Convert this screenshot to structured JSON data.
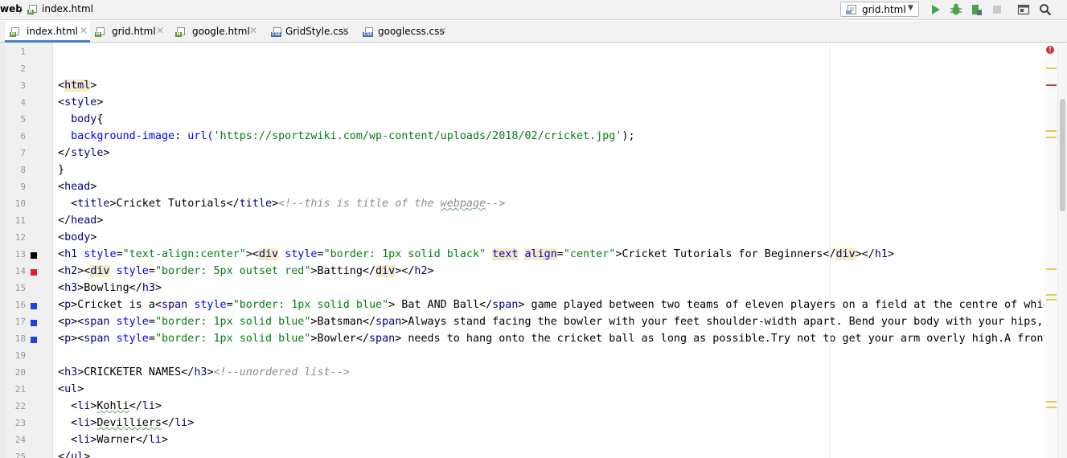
{
  "breadcrumb": {
    "root": "web",
    "separator": "〉",
    "file": "index.html"
  },
  "run_config": {
    "label": "grid.html"
  },
  "tabs": [
    {
      "label": "index.html",
      "close": "✕",
      "active": true,
      "icon": "html-file-icon"
    },
    {
      "label": "grid.html",
      "close": "✕",
      "active": false,
      "icon": "html-file-icon"
    },
    {
      "label": "google.html",
      "close": "✕",
      "active": false,
      "icon": "html-file-icon"
    },
    {
      "label": "GridStyle.css",
      "close": "✕",
      "active": false,
      "icon": "css-file-icon"
    },
    {
      "label": "googlecss.css",
      "close": "✕",
      "active": false,
      "icon": "css-file-icon"
    }
  ],
  "gutter": {
    "line_numbers": [
      "1",
      "2",
      "3",
      "4",
      "5",
      "6",
      "7",
      "8",
      "9",
      "10",
      "11",
      "12",
      "13",
      "14",
      "15",
      "16",
      "17",
      "18",
      "19",
      "20",
      "21",
      "22",
      "23",
      "24",
      "25"
    ],
    "color_markers": [
      {
        "line": "13",
        "color": "#000000"
      },
      {
        "line": "14",
        "color": "#e51f1f"
      },
      {
        "line": "16",
        "color": "#1f3fe5"
      },
      {
        "line": "17",
        "color": "#1f3fe5"
      },
      {
        "line": "18",
        "color": "#1f3fe5"
      }
    ]
  },
  "error_indicator": "!",
  "colors": {
    "accent": "#4083c9",
    "tag": "#000080",
    "attr": "#0000ff",
    "string": "#067d17",
    "comment": "#8c8c8c",
    "tag_highlight": "#f6ebbc",
    "warning_mark": "#e8c948",
    "error_mark": "#c94040"
  },
  "code_lines": [
    [],
    [],
    [
      {
        "t": "<",
        "c": "p"
      },
      {
        "t": "html",
        "c": "th"
      },
      {
        "t": ">",
        "c": "p"
      }
    ],
    [
      {
        "t": "<",
        "c": "p"
      },
      {
        "t": "style",
        "c": "t"
      },
      {
        "t": ">",
        "c": "p"
      }
    ],
    [
      {
        "t": "  ",
        "c": "p"
      },
      {
        "t": "body",
        "c": "t"
      },
      {
        "t": "{",
        "c": "p"
      }
    ],
    [
      {
        "t": "  ",
        "c": "p"
      },
      {
        "t": "background-image",
        "c": "a"
      },
      {
        "t": ": ",
        "c": "p"
      },
      {
        "t": "url(",
        "c": "a"
      },
      {
        "t": "'https://sportzwiki.com/wp-content/uploads/2018/02/cricket.jpg'",
        "c": "v"
      },
      {
        "t": ");",
        "c": "p"
      }
    ],
    [
      {
        "t": "</",
        "c": "p"
      },
      {
        "t": "style",
        "c": "t"
      },
      {
        "t": ">",
        "c": "p"
      }
    ],
    [
      {
        "t": "}",
        "c": "p"
      }
    ],
    [
      {
        "t": "<",
        "c": "p"
      },
      {
        "t": "head",
        "c": "t"
      },
      {
        "t": ">",
        "c": "p"
      }
    ],
    [
      {
        "t": "  <",
        "c": "p"
      },
      {
        "t": "title",
        "c": "t"
      },
      {
        "t": ">Cricket Tutorials</",
        "c": "p"
      },
      {
        "t": "title",
        "c": "t"
      },
      {
        "t": ">",
        "c": "p"
      },
      {
        "t": "<!--this is title of the ",
        "c": "cm"
      },
      {
        "t": "webpage",
        "c": "cmsq"
      },
      {
        "t": "-->",
        "c": "cm"
      }
    ],
    [
      {
        "t": "</",
        "c": "p"
      },
      {
        "t": "head",
        "c": "t"
      },
      {
        "t": ">",
        "c": "p"
      }
    ],
    [
      {
        "t": "<",
        "c": "p"
      },
      {
        "t": "body",
        "c": "t"
      },
      {
        "t": ">",
        "c": "p"
      }
    ],
    [
      {
        "t": "<",
        "c": "p"
      },
      {
        "t": "h1",
        "c": "t"
      },
      {
        "t": " ",
        "c": "p"
      },
      {
        "t": "style",
        "c": "a"
      },
      {
        "t": "=",
        "c": "p"
      },
      {
        "t": "\"text-align:center\"",
        "c": "v"
      },
      {
        "t": "><",
        "c": "p"
      },
      {
        "t": "div",
        "c": "th"
      },
      {
        "t": " ",
        "c": "p"
      },
      {
        "t": "style",
        "c": "a"
      },
      {
        "t": "=",
        "c": "p"
      },
      {
        "t": "\"border: 1px solid black\"",
        "c": "v"
      },
      {
        "t": " ",
        "c": "p"
      },
      {
        "t": "text",
        "c": "ah"
      },
      {
        "t": " ",
        "c": "p"
      },
      {
        "t": "align",
        "c": "ah"
      },
      {
        "t": "=",
        "c": "p"
      },
      {
        "t": "\"center\"",
        "c": "v"
      },
      {
        "t": ">Cricket Tutorials for Beginners</",
        "c": "p"
      },
      {
        "t": "div",
        "c": "th"
      },
      {
        "t": "></",
        "c": "p"
      },
      {
        "t": "h1",
        "c": "t"
      },
      {
        "t": ">",
        "c": "p"
      }
    ],
    [
      {
        "t": "<",
        "c": "p"
      },
      {
        "t": "h2",
        "c": "t"
      },
      {
        "t": "><",
        "c": "p"
      },
      {
        "t": "div",
        "c": "th"
      },
      {
        "t": " ",
        "c": "p"
      },
      {
        "t": "style",
        "c": "a"
      },
      {
        "t": "=",
        "c": "p"
      },
      {
        "t": "\"border: 5px outset red\"",
        "c": "v"
      },
      {
        "t": ">Batting</",
        "c": "p"
      },
      {
        "t": "div",
        "c": "th"
      },
      {
        "t": "></",
        "c": "p"
      },
      {
        "t": "h2",
        "c": "t"
      },
      {
        "t": ">",
        "c": "p"
      }
    ],
    [
      {
        "t": "<",
        "c": "p"
      },
      {
        "t": "h3",
        "c": "t"
      },
      {
        "t": ">Bowling</",
        "c": "p"
      },
      {
        "t": "h3",
        "c": "t"
      },
      {
        "t": ">",
        "c": "p"
      }
    ],
    [
      {
        "t": "<",
        "c": "p"
      },
      {
        "t": "p",
        "c": "t"
      },
      {
        "t": ">Cricket is a<",
        "c": "p"
      },
      {
        "t": "span",
        "c": "t"
      },
      {
        "t": " ",
        "c": "p"
      },
      {
        "t": "style",
        "c": "a"
      },
      {
        "t": "=",
        "c": "p"
      },
      {
        "t": "\"border: 1px solid blue\"",
        "c": "v"
      },
      {
        "t": "> Bat AND Ball</",
        "c": "p"
      },
      {
        "t": "span",
        "c": "t"
      },
      {
        "t": "> game played between two teams of eleven players on a field at the centre of which i",
        "c": "p"
      }
    ],
    [
      {
        "t": "<",
        "c": "p"
      },
      {
        "t": "p",
        "c": "t"
      },
      {
        "t": "><",
        "c": "p"
      },
      {
        "t": "span",
        "c": "t"
      },
      {
        "t": " ",
        "c": "p"
      },
      {
        "t": "style",
        "c": "a"
      },
      {
        "t": "=",
        "c": "p"
      },
      {
        "t": "\"border: 1px solid blue\"",
        "c": "v"
      },
      {
        "t": ">Batsman</",
        "c": "p"
      },
      {
        "t": "span",
        "c": "t"
      },
      {
        "t": ">Always stand facing the bowler with your feet shoulder-width apart. Bend your body with your hips, kee",
        "c": "p"
      }
    ],
    [
      {
        "t": "<",
        "c": "p"
      },
      {
        "t": "p",
        "c": "t"
      },
      {
        "t": "><",
        "c": "p"
      },
      {
        "t": "span",
        "c": "t"
      },
      {
        "t": " ",
        "c": "p"
      },
      {
        "t": "style",
        "c": "a"
      },
      {
        "t": "=",
        "c": "p"
      },
      {
        "t": "\"border: 1px solid blue\"",
        "c": "v"
      },
      {
        "t": ">Bowler</",
        "c": "p"
      },
      {
        "t": "span",
        "c": "t"
      },
      {
        "t": "> needs to hang onto the cricket ball as long as possible.Try not to get your arm overly high.A front or",
        "c": "p"
      }
    ],
    [],
    [
      {
        "t": "<",
        "c": "p"
      },
      {
        "t": "h3",
        "c": "t"
      },
      {
        "t": ">CRICKETER NAMES</",
        "c": "p"
      },
      {
        "t": "h3",
        "c": "t"
      },
      {
        "t": ">",
        "c": "p"
      },
      {
        "t": "<!--unordered list-->",
        "c": "cm"
      }
    ],
    [
      {
        "t": "<",
        "c": "p"
      },
      {
        "t": "ul",
        "c": "t"
      },
      {
        "t": ">",
        "c": "p"
      }
    ],
    [
      {
        "t": "  <",
        "c": "p"
      },
      {
        "t": "li",
        "c": "t"
      },
      {
        "t": ">",
        "c": "p"
      },
      {
        "t": "Kohli",
        "c": "psq"
      },
      {
        "t": "</",
        "c": "p"
      },
      {
        "t": "li",
        "c": "t"
      },
      {
        "t": ">",
        "c": "p"
      }
    ],
    [
      {
        "t": "  <",
        "c": "p"
      },
      {
        "t": "li",
        "c": "t"
      },
      {
        "t": ">",
        "c": "p"
      },
      {
        "t": "Devilliers",
        "c": "psq"
      },
      {
        "t": "</",
        "c": "p"
      },
      {
        "t": "li",
        "c": "t"
      },
      {
        "t": ">",
        "c": "p"
      }
    ],
    [
      {
        "t": "  <",
        "c": "p"
      },
      {
        "t": "li",
        "c": "t"
      },
      {
        "t": ">Warner</",
        "c": "p"
      },
      {
        "t": "li",
        "c": "t"
      },
      {
        "t": ">",
        "c": "p"
      }
    ],
    [
      {
        "t": "</",
        "c": "p"
      },
      {
        "t": "ul",
        "c": "t"
      },
      {
        "t": ">",
        "c": "p"
      }
    ]
  ],
  "error_stripe_marks": [
    {
      "line": "2",
      "color": "#e8c948"
    },
    {
      "line": "3",
      "color": "#c94040"
    },
    {
      "line": "6",
      "color": "#e8c948"
    },
    {
      "line": "6b",
      "color": "#e8c948"
    },
    {
      "line": "14",
      "color": "#e8c948"
    },
    {
      "line": "16",
      "color": "#e8c948"
    },
    {
      "line": "16b",
      "color": "#e8c948"
    },
    {
      "line": "22",
      "color": "#e8c948"
    },
    {
      "line": "22b",
      "color": "#e8c948"
    }
  ]
}
